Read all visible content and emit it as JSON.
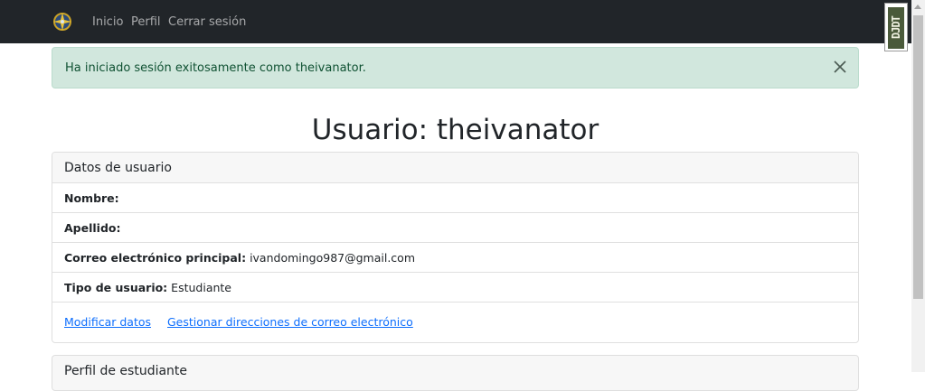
{
  "nav": {
    "logo_icon": "compass-logo-icon",
    "links": [
      "Inicio",
      "Perfil",
      "Cerrar sesión"
    ]
  },
  "debug_toolbar": {
    "label": "DJDT"
  },
  "alert": {
    "message": "Ha iniciado sesión exitosamente como theivanator.",
    "close_icon": "close-icon",
    "color": "#d1e7dd"
  },
  "page_title": "Usuario: theivanator",
  "user_card": {
    "header": "Datos de usuario",
    "fields": [
      {
        "label": "Nombre:",
        "value": ""
      },
      {
        "label": "Apellido:",
        "value": ""
      },
      {
        "label": "Correo electrónico principal:",
        "value": "ivandomingo987@gmail.com"
      },
      {
        "label": "Tipo de usuario:",
        "value": "Estudiante"
      }
    ],
    "links": [
      "Modificar datos",
      "Gestionar direcciones de correo electrónico"
    ]
  },
  "student_card": {
    "header": "Perfil de estudiante"
  },
  "colors": {
    "navbar": "#212529",
    "link": "#0d6efd",
    "alert_text": "#0f5132"
  }
}
